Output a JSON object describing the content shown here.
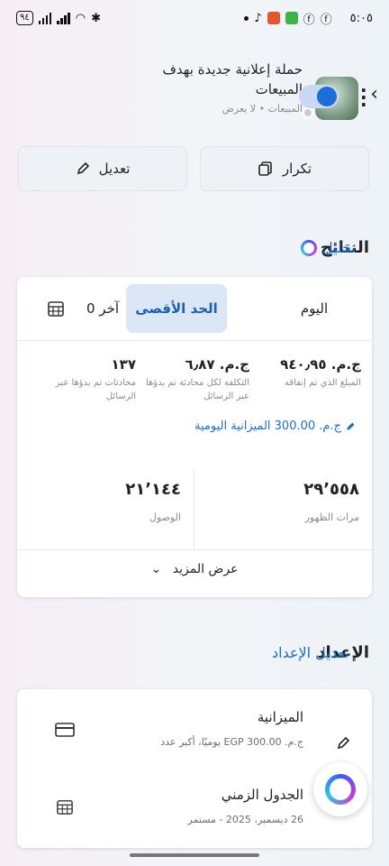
{
  "status_bar": {
    "time": "٥:٠٥",
    "battery": "٩٤"
  },
  "header": {
    "title": "حملة إعلانية جديدة بهدف المبيعات",
    "subtitle": "المبيعات • لا يعرض",
    "toggle_on": true
  },
  "actions": {
    "repeat_label": "تكرار",
    "edit_label": "تعديل"
  },
  "results": {
    "title": "النتائج",
    "analyze_label": "تحليل",
    "tabs": {
      "today": "اليوم",
      "max": "الحد الأقصى",
      "other": "آخر 0"
    },
    "metrics": [
      {
        "value": "ج.م. ٩٤٠٫٩٥",
        "label": "المبلغ الذي تم إنفاقه"
      },
      {
        "value": "ج.م. ٦٫٨٧",
        "label": "التكلفة لكل محادثة تم بدؤها عبر الرسائل"
      },
      {
        "value": "١٣٧",
        "label": "محادثات تم بدؤها عبر الرسائل"
      }
    ],
    "daily_budget": "ج.م. 300.00 الميزانية اليومية",
    "impressions": {
      "value": "٢٩٬٥٥٨",
      "label": "مرات الظهور"
    },
    "reach": {
      "value": "٢١٬١٤٤",
      "label": "الوصول"
    },
    "show_more": "عرض المزيد"
  },
  "setup": {
    "title": "الإعداد",
    "edit_link": "تعديل الإعداد",
    "budget": {
      "title": "الميزانية",
      "sub": "ج.م. EGP 300.00 يوميًا، أكبر عدد"
    },
    "schedule": {
      "title": "الجدول الزمني",
      "sub": "26 ديسمبر، 2025 - مستمر"
    }
  },
  "colors": {
    "accent": "#1a6fcf",
    "toggle": "#1c6fd8",
    "tab_active_bg": "#dbe7f6"
  }
}
